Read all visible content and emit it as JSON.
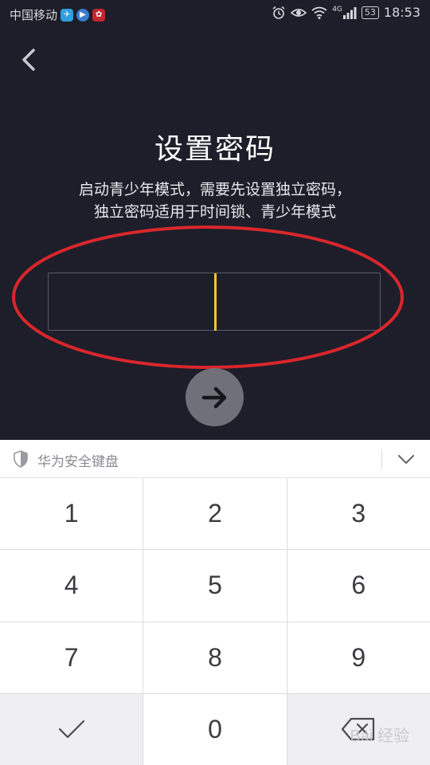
{
  "status_bar": {
    "carrier": "中国移动",
    "signal_label": "4G",
    "battery": "53",
    "time": "18:53"
  },
  "page": {
    "title": "设置密码",
    "description_line1": "启动青少年模式，需要先设置独立密码，",
    "description_line2": "独立密码适用于时间锁、青少年模式"
  },
  "keyboard": {
    "title": "华为安全键盘",
    "keys": [
      "1",
      "2",
      "3",
      "4",
      "5",
      "6",
      "7",
      "8",
      "9",
      "0"
    ]
  },
  "watermark": "Bai 经验",
  "colors": {
    "background": "#1d1e29",
    "cursor": "#f6c536",
    "highlight": "#d9262c",
    "next_button": "#6f7078"
  }
}
